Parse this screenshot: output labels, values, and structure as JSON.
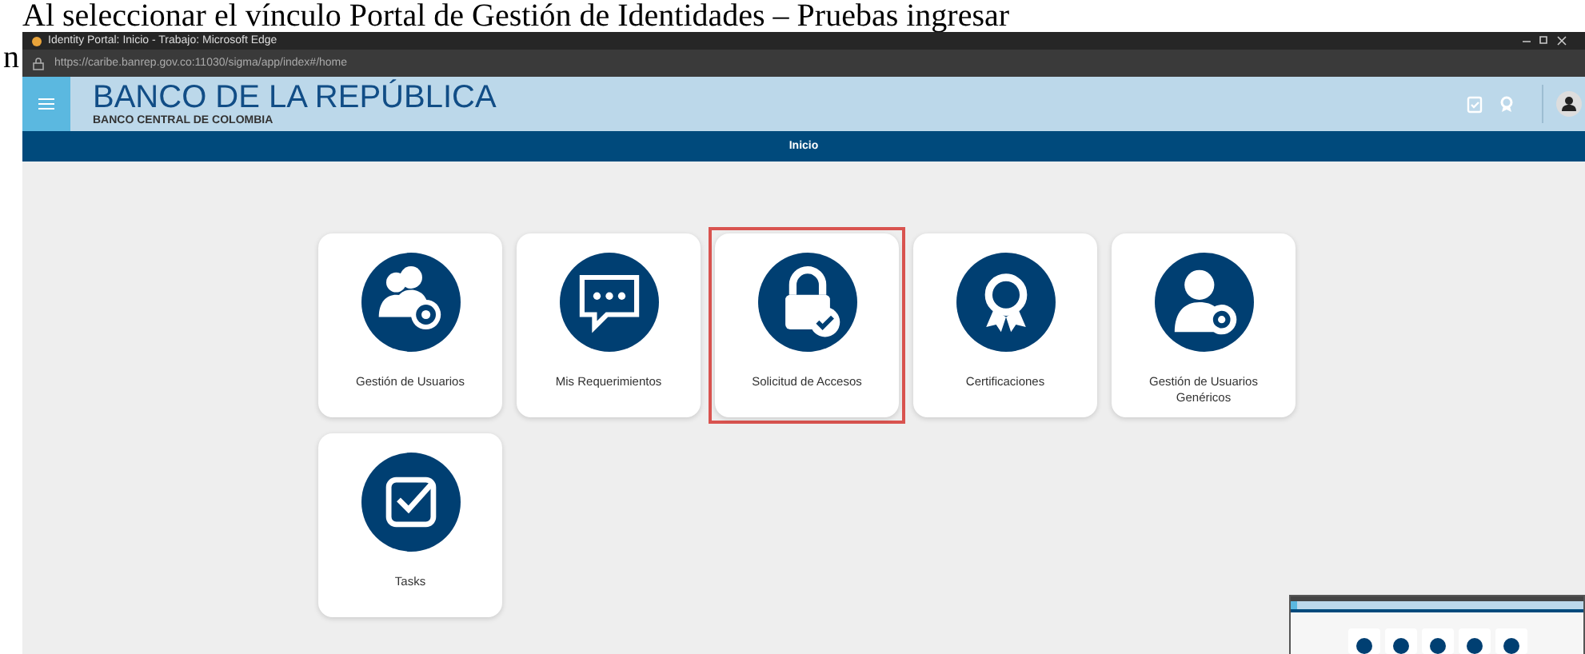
{
  "document_text": [
    "Al seleccionar el vínculo Portal de Gestión de Identidades – Pruebas ingresar",
    "n"
  ],
  "window": {
    "title": "Identity Portal: Inicio - Trabajo: Microsoft Edge",
    "url": "https://caribe.banrep.gov.co:11030/sigma/app/index#/home"
  },
  "header": {
    "title": "BANCO DE LA REPÚBLICA",
    "subtitle": "BANCO CENTRAL DE COLOMBIA"
  },
  "nav": {
    "label": "Inicio"
  },
  "tiles": [
    {
      "label": "Gestión de Usuarios",
      "kind": "users",
      "selected": false
    },
    {
      "label": "Mis Requerimientos",
      "kind": "chat",
      "selected": false
    },
    {
      "label": "Solicitud de Accesos",
      "kind": "lock",
      "selected": true
    },
    {
      "label": "Certificaciones",
      "kind": "award",
      "selected": false
    },
    {
      "label": "Gestión de Usuarios Genéricos",
      "kind": "user",
      "selected": false
    },
    {
      "label": "Tasks",
      "kind": "tasks",
      "selected": false
    }
  ]
}
